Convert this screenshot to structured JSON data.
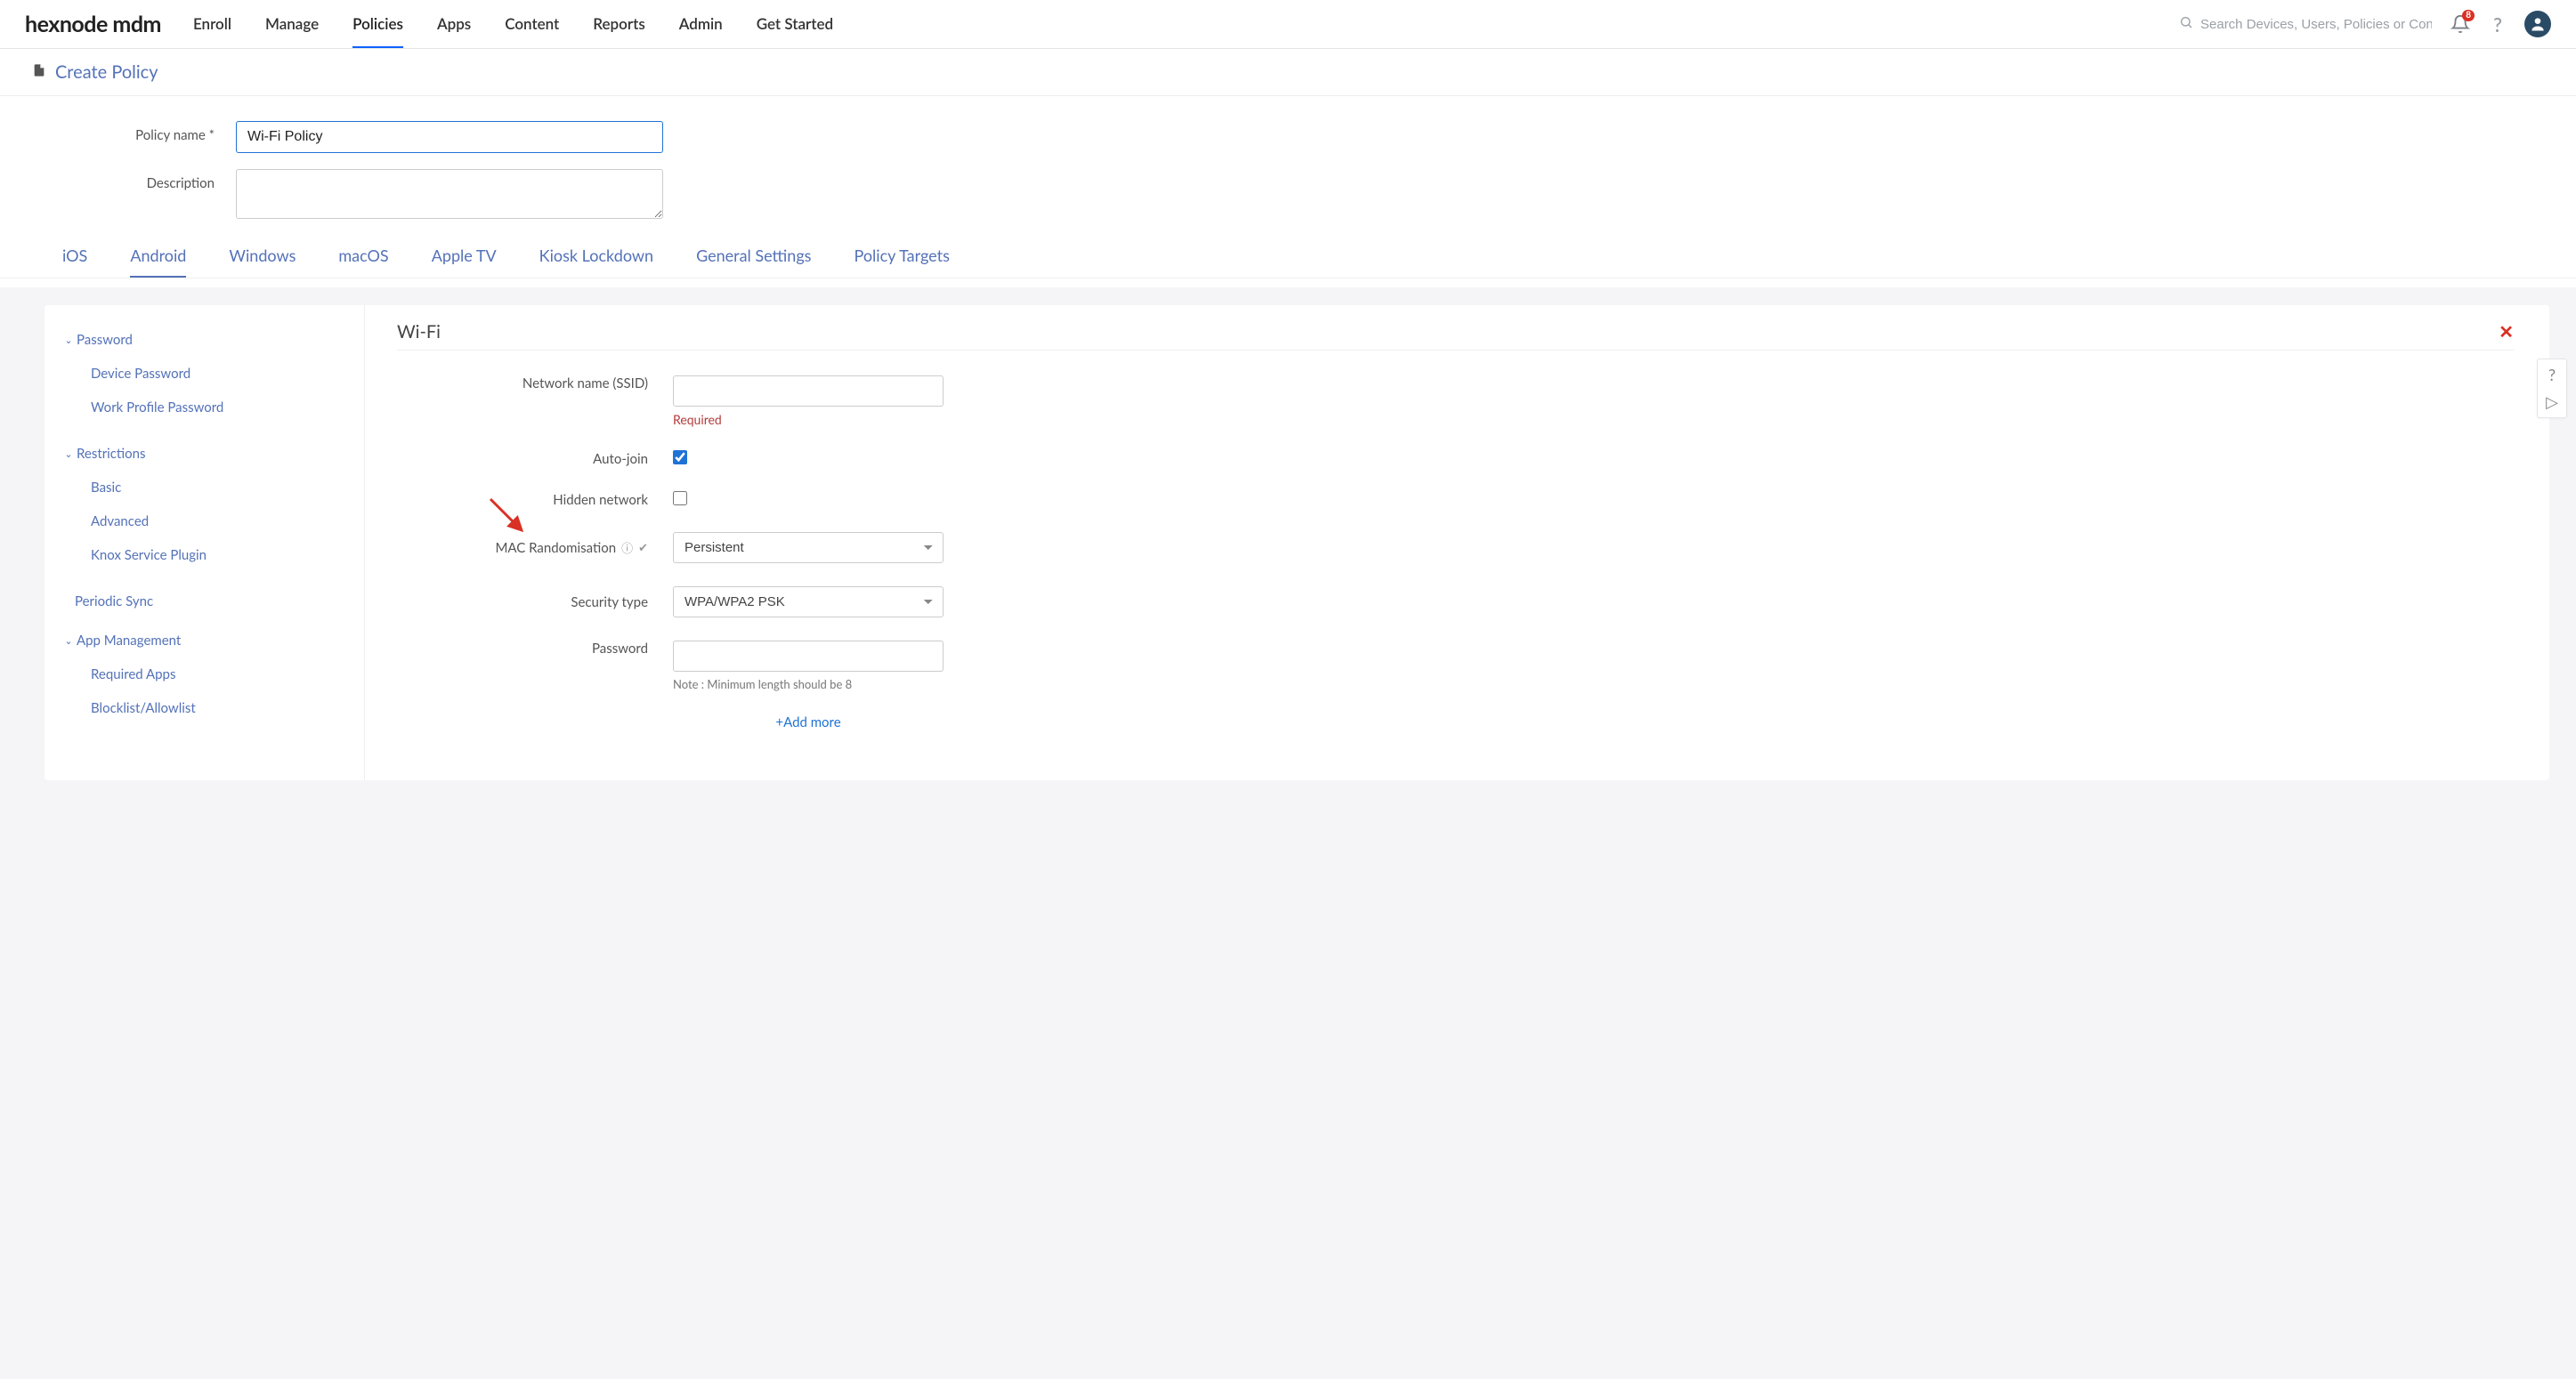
{
  "brand": "hexnode mdm",
  "topnav": [
    {
      "label": "Enroll",
      "active": false
    },
    {
      "label": "Manage",
      "active": false
    },
    {
      "label": "Policies",
      "active": true
    },
    {
      "label": "Apps",
      "active": false
    },
    {
      "label": "Content",
      "active": false
    },
    {
      "label": "Reports",
      "active": false
    },
    {
      "label": "Admin",
      "active": false
    },
    {
      "label": "Get Started",
      "active": false
    }
  ],
  "search_placeholder": "Search Devices, Users, Policies or Content",
  "notif_badge": "8",
  "page_title": "Create Policy",
  "form": {
    "name_label": "Policy name *",
    "name_value": "Wi-Fi Policy",
    "desc_label": "Description",
    "desc_value": ""
  },
  "platform_tabs": [
    {
      "label": "iOS",
      "active": false
    },
    {
      "label": "Android",
      "active": true
    },
    {
      "label": "Windows",
      "active": false
    },
    {
      "label": "macOS",
      "active": false
    },
    {
      "label": "Apple TV",
      "active": false
    },
    {
      "label": "Kiosk Lockdown",
      "active": false
    },
    {
      "label": "General Settings",
      "active": false
    },
    {
      "label": "Policy Targets",
      "active": false
    }
  ],
  "sidebar": {
    "s1": {
      "header": "Password",
      "items": [
        "Device Password",
        "Work Profile Password"
      ]
    },
    "s2": {
      "header": "Restrictions",
      "items": [
        "Basic",
        "Advanced",
        "Knox Service Plugin"
      ]
    },
    "periodic": "Periodic Sync",
    "s3": {
      "header": "App Management",
      "items": [
        "Required Apps",
        "Blocklist/Allowlist"
      ]
    }
  },
  "wifi": {
    "heading": "Wi-Fi",
    "ssid_label": "Network name (SSID)",
    "ssid_value": "",
    "ssid_required": "Required",
    "autojoin_label": "Auto-join",
    "hidden_label": "Hidden network",
    "macrand_label": "MAC Randomisation",
    "macrand_value": "Persistent",
    "sectype_label": "Security type",
    "sectype_value": "WPA/WPA2 PSK",
    "password_label": "Password",
    "password_value": "",
    "password_note": "Note : Minimum length should be 8",
    "add_more": "+Add more"
  }
}
